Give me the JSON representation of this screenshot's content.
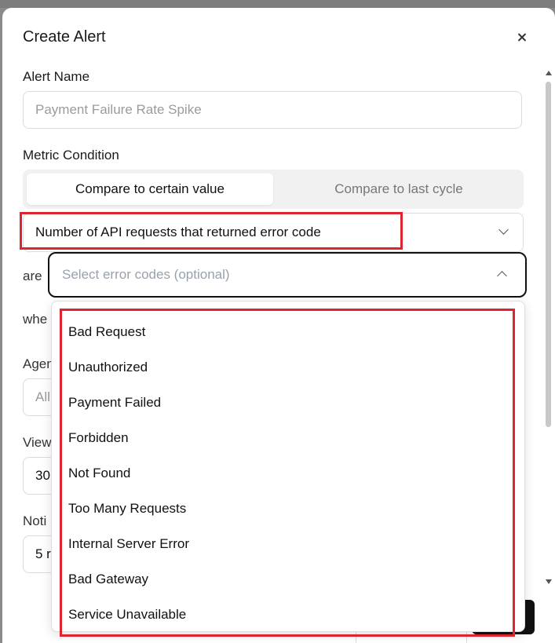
{
  "modal": {
    "title": "Create Alert"
  },
  "alert_name": {
    "label": "Alert Name",
    "placeholder": "Payment Failure Rate Spike"
  },
  "metric_condition": {
    "label": "Metric Condition",
    "tabs": [
      "Compare to certain value",
      "Compare to last cycle"
    ],
    "active_tab": "Compare to certain value",
    "metric_value": "Number of API requests that returned error code",
    "are_label": "are",
    "error_codes_placeholder": "Select error codes (optional)"
  },
  "error_code_options": [
    "Bad Request",
    "Unauthorized",
    "Payment Failed",
    "Forbidden",
    "Not Found",
    "Too Many Requests",
    "Internal Server Error",
    "Bad Gateway",
    "Service Unavailable"
  ],
  "obscured": {
    "when_partial": "whe",
    "agent_label_partial": "Agen",
    "agent_value_partial": "All",
    "view_label_partial": "View",
    "view_value_partial": "30",
    "notify_label_partial": "Noti",
    "notify_value_partial": "5 r"
  },
  "highlight_color": "#e0232c"
}
